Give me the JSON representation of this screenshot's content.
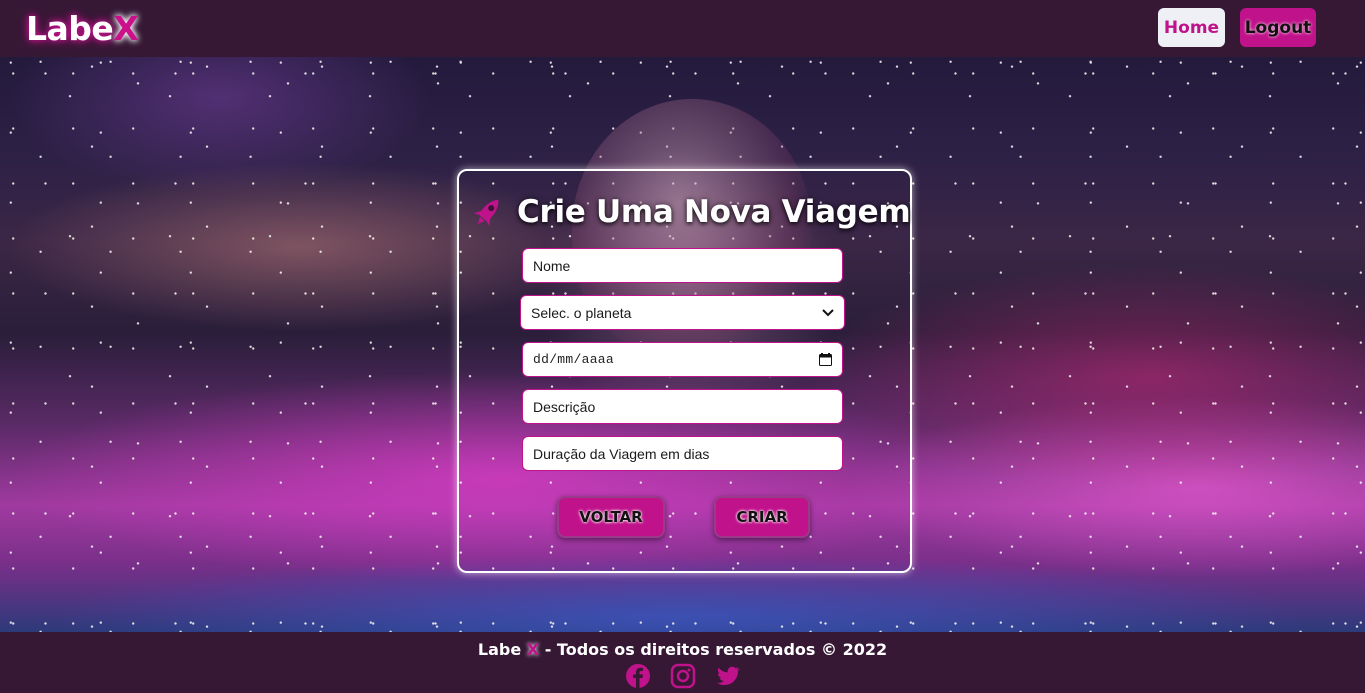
{
  "brand": {
    "name_main": "Labe",
    "name_accent": "X"
  },
  "nav": {
    "home_label": "Home",
    "logout_label": "Logout"
  },
  "form": {
    "title": "Crie Uma Nova Viagem",
    "name_placeholder": "Nome",
    "planet_select_value": "Selec. o planeta",
    "date_placeholder": "dd/mm/aaaa",
    "description_placeholder": "Descrição",
    "duration_placeholder": "Duração da Viagem em dias",
    "back_label": "VOLTAR",
    "create_label": "CRIAR"
  },
  "footer": {
    "brand_main": "Labe",
    "brand_accent": "X",
    "rights_text": "- Todos os direitos reservados © 2022",
    "social": [
      "facebook-icon",
      "instagram-icon",
      "twitter-icon"
    ]
  },
  "colors": {
    "accent": "#c0128a",
    "header_bg": "#361835",
    "white": "#ffffff"
  }
}
